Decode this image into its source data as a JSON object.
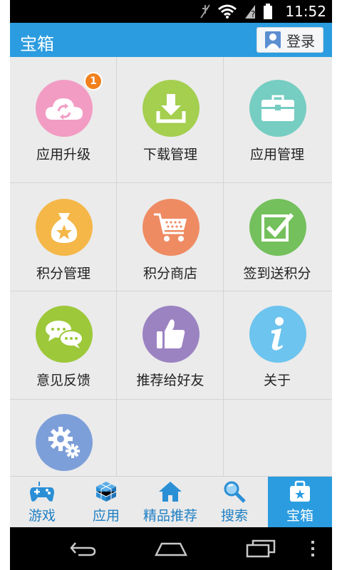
{
  "status_bar": {
    "time": "11:52"
  },
  "title_bar": {
    "title": "宝箱",
    "login_label": "登录"
  },
  "grid": {
    "items": [
      {
        "label": "应用升级",
        "color": "#f29cc4",
        "icon": "cloud-sync-icon",
        "badge": "1"
      },
      {
        "label": "下载管理",
        "color": "#a4cf4f",
        "icon": "download-icon"
      },
      {
        "label": "应用管理",
        "color": "#76cdc2",
        "icon": "briefcase-icon"
      },
      {
        "label": "积分管理",
        "color": "#f4b748",
        "icon": "money-bag-icon"
      },
      {
        "label": "积分商店",
        "color": "#ef8b63",
        "icon": "cart-icon"
      },
      {
        "label": "签到送积分",
        "color": "#74c05c",
        "icon": "checkbox-icon"
      },
      {
        "label": "意见反馈",
        "color": "#9dc83a",
        "icon": "chat-bubbles-icon"
      },
      {
        "label": "推荐给好友",
        "color": "#9b83c2",
        "icon": "thumbs-up-icon"
      },
      {
        "label": "关于",
        "color": "#6dc4ee",
        "icon": "info-icon"
      },
      {
        "label": "",
        "color": "#7d9fd9",
        "icon": "settings-gears-icon"
      }
    ]
  },
  "tab_bar": {
    "tabs": [
      {
        "label": "游戏",
        "icon": "gamepad-icon"
      },
      {
        "label": "应用",
        "icon": "cube-icon"
      },
      {
        "label": "精品推荐",
        "icon": "home-icon"
      },
      {
        "label": "搜索",
        "icon": "search-icon"
      },
      {
        "label": "宝箱",
        "icon": "treasure-box-icon",
        "active": true
      }
    ]
  },
  "colors": {
    "accent": "#2b9ce0",
    "tab_text": "#1e7fc4",
    "badge": "#f2811d"
  }
}
